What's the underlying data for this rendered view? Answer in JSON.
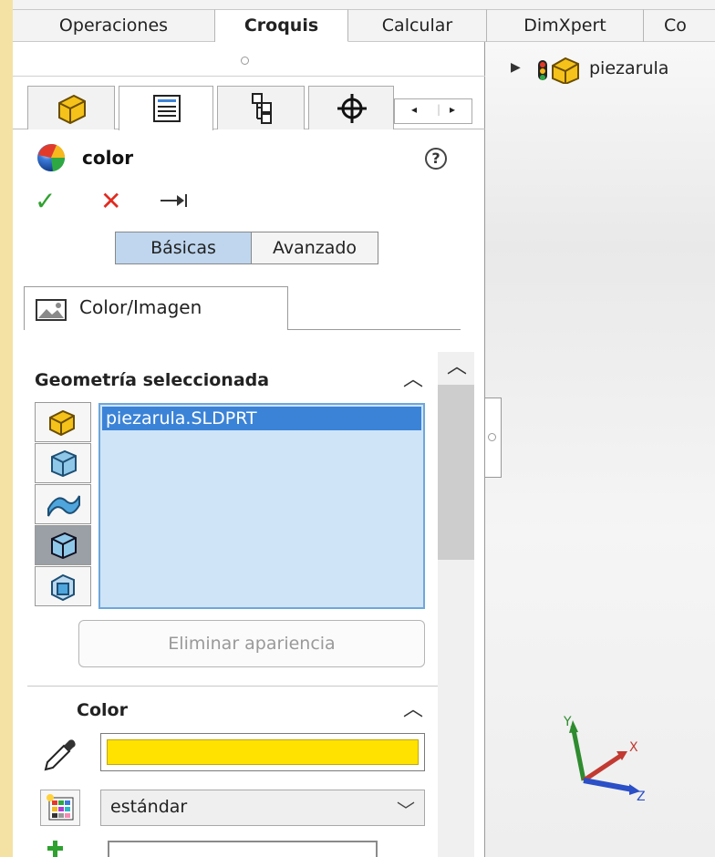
{
  "tabs": [
    "Operaciones",
    "Croquis",
    "Calcular",
    "DimXpert",
    "Co"
  ],
  "active_tab": "Croquis",
  "panel": {
    "title": "color",
    "help_glyph": "?",
    "ok_glyph": "✓",
    "cancel_glyph": "✕",
    "pin_glyph": "⊣◂",
    "mode_buttons": [
      "Básicas",
      "Avanzado"
    ],
    "active_mode": "Básicas",
    "subtab": "Color/Imagen",
    "geometry": {
      "heading": "Geometría seleccionada",
      "items": [
        "piezarula.SLDPRT"
      ],
      "remove_button": "Eliminar apariencia"
    },
    "color": {
      "heading": "Color",
      "swatch_color": "#ffe200",
      "palette_select": "estándar"
    },
    "palette_colors": [
      "#f9c4c4",
      "#fbe3bd",
      "#f6f4b4",
      "#c8f3c8",
      "#c6eef6",
      "#c8cbf6",
      "#f1c9f1",
      "#ffffff"
    ]
  },
  "viewport": {
    "tree_node": "piezarula",
    "triad": {
      "x": "X",
      "y": "Y",
      "z": "Z"
    }
  }
}
